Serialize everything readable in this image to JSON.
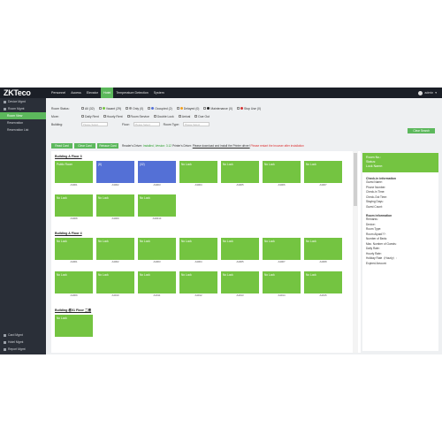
{
  "topbar": {
    "logo": "ZKTeco",
    "nav": [
      "Personnel",
      "Access",
      "Elevator",
      "Hotel",
      "Temperature Detection",
      "System"
    ],
    "active_nav": "Hotel",
    "user": "admin"
  },
  "sidebar": {
    "items": [
      {
        "label": "Device Mgmt",
        "sub": false
      },
      {
        "label": "Room Mgmt",
        "sub": false
      },
      {
        "label": "Room View",
        "sub": true,
        "active": true
      },
      {
        "label": "Reservation",
        "sub": true
      },
      {
        "label": "Reservation List",
        "sub": true
      }
    ],
    "bottom_items": [
      "Card Mgmt",
      "Hotel Mgmt",
      "Report Mgmt"
    ]
  },
  "filter": {
    "room_status_label": "Room Status:",
    "statuses": [
      {
        "label": "All",
        "count": "(32)",
        "color": ""
      },
      {
        "label": "Vacant",
        "count": "(29)",
        "color": "#74c441"
      },
      {
        "label": "Only",
        "count": "(0)",
        "color": "#999999"
      },
      {
        "label": "Occupied",
        "count": "(2)",
        "color": "#5470d6"
      },
      {
        "label": "Delayed",
        "count": "(0)",
        "color": "#f0a020"
      },
      {
        "label": "Maintenance",
        "count": "(0)",
        "color": "#222222"
      },
      {
        "label": "Stop Use",
        "count": "(0)",
        "color": "#d33333"
      }
    ],
    "more_label": "More:",
    "more": [
      "Daily Rent",
      "Hourly Rent",
      "Room Service",
      "Double Lock",
      "Arrival",
      "Due Out"
    ],
    "building_label": "Building:",
    "floor_label": "Floor:",
    "room_type_label": "Room Type:",
    "placeholder": "Please Select",
    "clear_button": "Clear Search"
  },
  "actions": {
    "read_card": "Read Card",
    "clear_card": "Clear Card",
    "reissue_card": "Reissue Card",
    "driver_prefix": "Reader's Driver:",
    "driver_status": "Installed, Version: 3.12",
    "printer_prefix": "Printer's Driver:",
    "printer_link": "Please download and install the Printer driver!",
    "restart_note": "Please restart the browser after installation"
  },
  "buildings": [
    {
      "title": "Building A   Floor 3",
      "rooms": [
        {
          "label": "Public Room",
          "number": "A3001",
          "occupied": false
        },
        {
          "label": "(8)",
          "number": "A3002",
          "occupied": true
        },
        {
          "label": "(32)",
          "number": "A3003",
          "occupied": true
        },
        {
          "label": "No Lock",
          "number": "A3004",
          "occupied": false
        },
        {
          "label": "No Lock",
          "number": "A3005",
          "occupied": false
        },
        {
          "label": "No Lock",
          "number": "A3006",
          "occupied": false
        },
        {
          "label": "No Lock",
          "number": "A3007",
          "occupied": false
        },
        {
          "label": "No Lock",
          "number": "A3008",
          "occupied": false
        },
        {
          "label": "No Lock",
          "number": "A3009",
          "occupied": false
        },
        {
          "label": "No Lock",
          "number": "A30010",
          "occupied": false
        }
      ]
    },
    {
      "title": "Building A   Floor 4",
      "rooms": [
        {
          "label": "No Lock",
          "number": "A4001",
          "occupied": false
        },
        {
          "label": "No Lock",
          "number": "A4002",
          "occupied": false
        },
        {
          "label": "No Lock",
          "number": "A4003",
          "occupied": false
        },
        {
          "label": "No Lock",
          "number": "A4004",
          "occupied": false
        },
        {
          "label": "No Lock",
          "number": "A4005",
          "occupied": false
        },
        {
          "label": "No Lock",
          "number": "A4007",
          "occupied": false
        },
        {
          "label": "No Lock",
          "number": "A4008",
          "occupied": false
        },
        {
          "label": "No Lock",
          "number": "A4009",
          "occupied": false
        },
        {
          "label": "No Lock",
          "number": "A4010",
          "occupied": false
        },
        {
          "label": "No Lock",
          "number": "A4011",
          "occupied": false
        },
        {
          "label": "No Lock",
          "number": "A4012",
          "occupied": false
        },
        {
          "label": "No Lock",
          "number": "A4013",
          "occupied": false
        },
        {
          "label": "No Lock",
          "number": "A4014",
          "occupied": false
        },
        {
          "label": "No Lock",
          "number": "A4015",
          "occupied": false
        }
      ]
    },
    {
      "title": "Building 栋01   Floor 二楼",
      "rooms": [
        {
          "label": "No Lock",
          "number": "",
          "occupied": false
        }
      ]
    }
  ],
  "detail": {
    "room_no": "Room No.:",
    "status": "Status:",
    "lock_name": "Lock Name:",
    "checkin_title": "Check-in information",
    "checkin_fields": [
      "Guest Name:",
      "Phone Number:",
      "Check-in Time:",
      "Check-Out Time:",
      "Staying Days:",
      "Guest Count:"
    ],
    "room_title": "Room information",
    "room_fields": [
      "Remarks:",
      "Device:",
      "Room Type:",
      "Room Alpaid??:",
      "Number of Beds:",
      "Max. Number of Guests:",
      "Daily Rate:",
      "Hourly Rate:",
      "Holiday Rate（Hourly）:",
      "Expired Amount:"
    ]
  }
}
